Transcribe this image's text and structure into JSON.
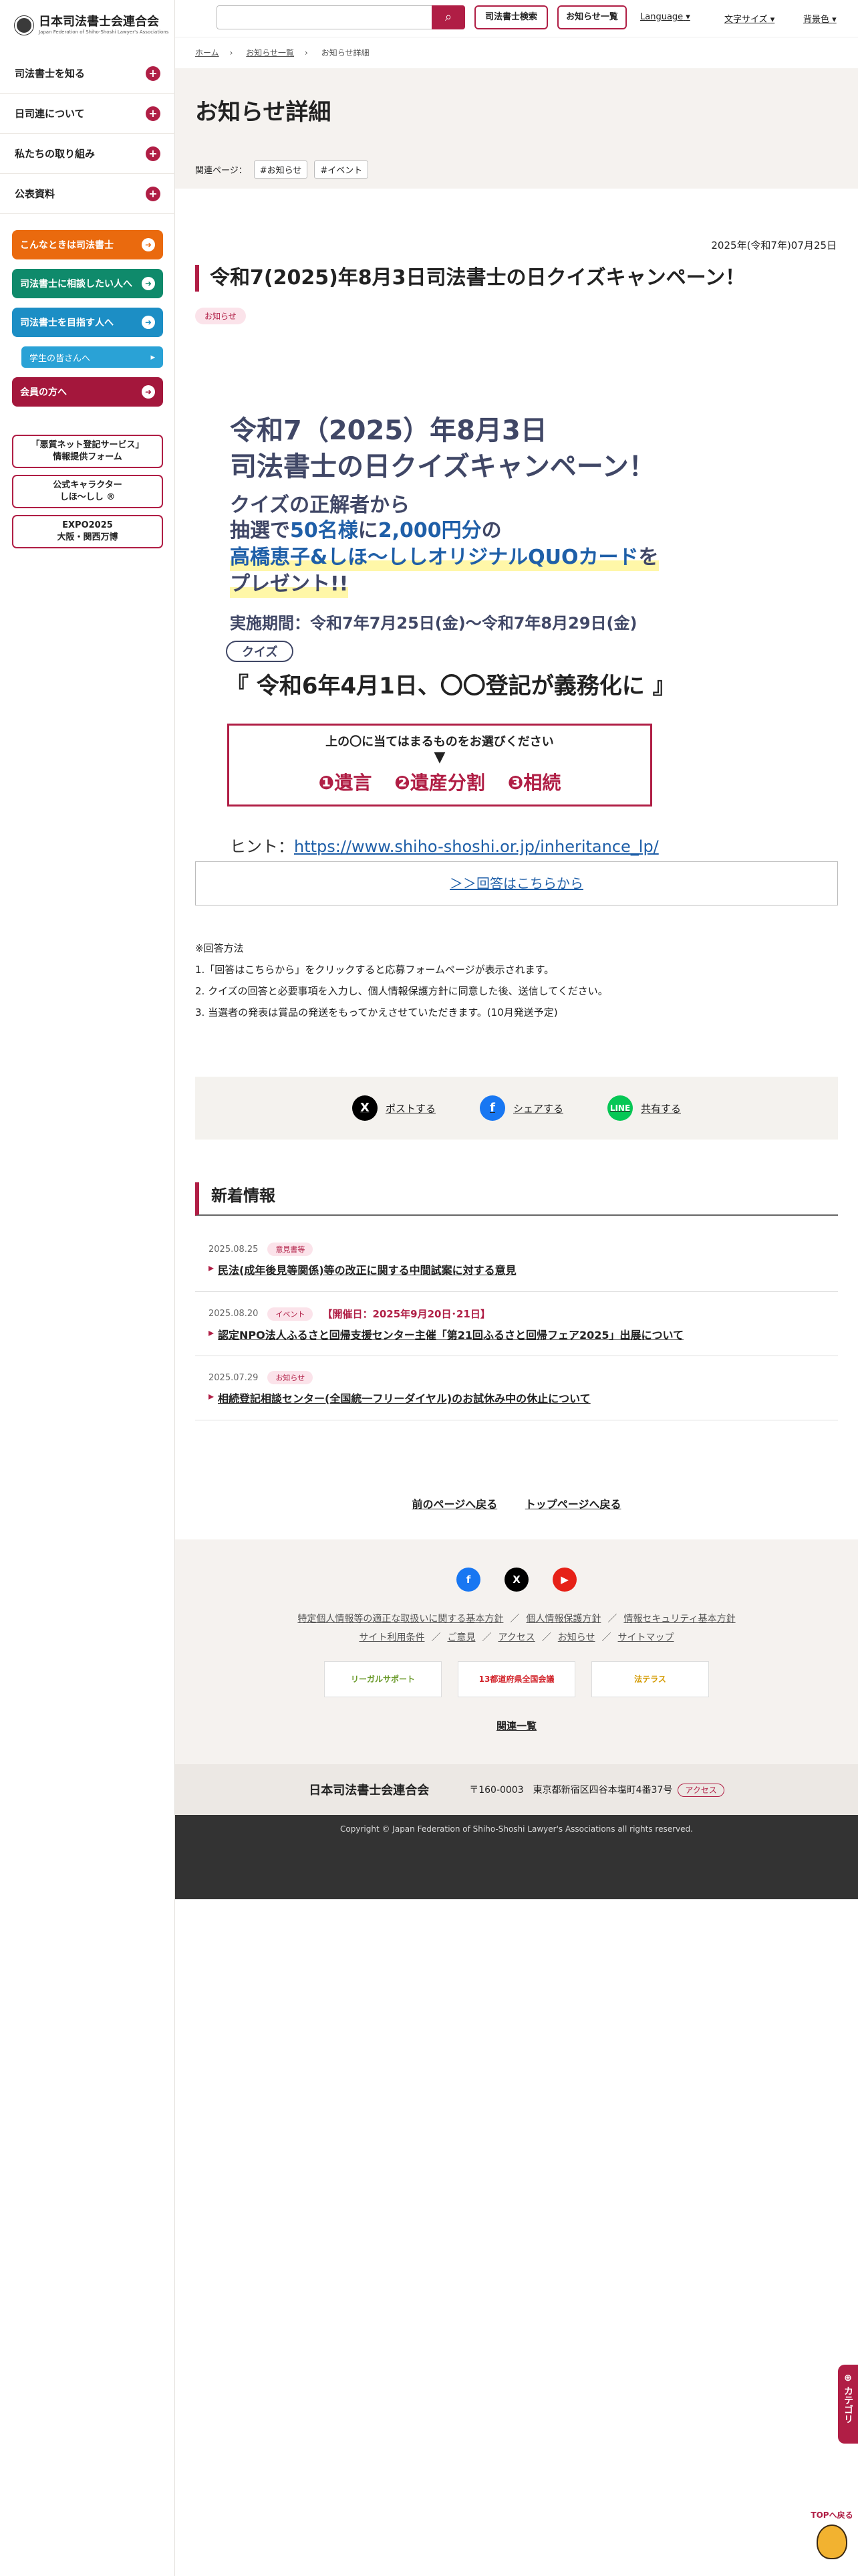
{
  "org": {
    "name": "日本司法書士会連合会",
    "name_en": "Japan Federation of Shiho-Shoshi Lawyer's Associations"
  },
  "header": {
    "search_placeholder": "",
    "btn_find": "司法書士検索",
    "btn_news": "お知らせ一覧",
    "language": "Language",
    "font_size": "文字サイズ",
    "bg_color": "背景色"
  },
  "sidebar": {
    "nav": [
      {
        "label": "司法書士を知る"
      },
      {
        "label": "日司連について"
      },
      {
        "label": "私たちの取り組み"
      },
      {
        "label": "公表資料"
      }
    ],
    "color_buttons": [
      {
        "label": "こんなときは司法書士",
        "color": "#ea6a0e"
      },
      {
        "label": "司法書士に相談したい人へ",
        "color": "#0f8a6b"
      },
      {
        "label": "司法書士を目指す人へ",
        "color": "#1c8ec5"
      },
      {
        "label": "学生の皆さんへ",
        "color": "#2aa2d6"
      },
      {
        "label": "会員の方へ",
        "color": "#a4173c"
      }
    ],
    "outline_buttons": [
      {
        "line1": "「悪質ネット登記サービス」",
        "line2": "情報提供フォーム"
      },
      {
        "line1": "公式キャラクター",
        "line2": "しほ～しし ®"
      },
      {
        "line1": "EXPO2025",
        "line2": "大阪・関西万博"
      }
    ]
  },
  "breadcrumb": [
    "ホーム",
    "お知らせ一覧",
    "お知らせ詳細"
  ],
  "page": {
    "title": "お知らせ詳細",
    "related_label": "関連ページ：",
    "related_tags": [
      "#お知らせ",
      "#イベント"
    ]
  },
  "article": {
    "date": "2025年(令和7年)07月25日",
    "title": "令和7(2025)年8月3日司法書士の日クイズキャンペーン！",
    "category": "お知らせ",
    "campaign": {
      "line1": "令和7（2025）年8月3日",
      "line2": "司法書士の日クイズキャンペーン！",
      "prize1": "クイズの正解者から",
      "prize2a": "抽選で",
      "prize2b": "50名様",
      "prize2c": "に",
      "prize2d": "2,000円分",
      "prize2e": "の",
      "prize3a": "高橋恵子&しほ～しし",
      "prize3b": "オリジナルQUOカード",
      "prize3c": "を",
      "prize4": "プレゼント!!",
      "period": "実施期間：令和7年7月25日(金)～令和7年8月29日(金)",
      "quiz_label": "クイズ",
      "question": "『 令和6年4月1日、〇〇登記が義務化に 』",
      "instruction": "上の〇に当てはまるものをお選びください",
      "down": "▼",
      "options": [
        "❶遺言",
        "❷遺産分割",
        "❸相続"
      ],
      "hint_label": "ヒント：",
      "hint_url": "https://www.shiho-shoshi.or.jp/inheritance_lp/"
    },
    "answer_link": "＞＞回答はこちらから",
    "method_title": "※回答方法",
    "method": [
      "1.「回答はこちらから」をクリックすると応募フォームページが表示されます。",
      "2. クイズの回答と必要事項を入力し、個人情報保護方針に同意した後、送信してください。",
      "3. 当選者の発表は賞品の発送をもってかえさせていただきます。(10月発送予定)"
    ]
  },
  "share": [
    {
      "label": "ポストする",
      "icon": "x-icon",
      "color": "#000000"
    },
    {
      "label": "シェアする",
      "icon": "facebook-icon",
      "color": "#1877f2"
    },
    {
      "label": "共有する",
      "icon": "line-icon",
      "color": "#06c755"
    }
  ],
  "news": {
    "heading": "新着情報",
    "items": [
      {
        "date": "2025.08.25",
        "category": "意見書等",
        "sub": "",
        "title": "民法(成年後見等関係)等の改正に関する中間試案に対する意見"
      },
      {
        "date": "2025.08.20",
        "category": "イベント",
        "sub": "【開催日：2025年9月20日･21日】",
        "title": "認定NPO法人ふるさと回帰支援センター主催「第21回ふるさと回帰フェア2025」出展について"
      },
      {
        "date": "2025.07.29",
        "category": "お知らせ",
        "sub": "",
        "title": "相続登記相談センター(全国統一フリーダイヤル)のお試休み中の休止について"
      }
    ]
  },
  "pager": {
    "prev": "前のページへ戻る",
    "top": "トップページへ戻る"
  },
  "footer": {
    "links1": [
      "特定個人情報等の適正な取扱いに関する基本方針",
      "個人情報保護方針",
      "情報セキュリティ基本方針"
    ],
    "links2": [
      "サイト利用条件",
      "ご意見",
      "アクセス",
      "お知らせ",
      "サイトマップ"
    ],
    "banners": [
      "リーガルサポート",
      "13都道府県全国会議",
      "法テラス"
    ],
    "list_link": "関連一覧",
    "postal": "〒160-0003",
    "address": "東京都新宿区四谷本塩町4番37号",
    "access": "アクセス",
    "copyright": "Copyright © Japan Federation of Shiho-Shoshi Lawyer's Associations all rights reserved."
  },
  "category_tab": "カテゴリ",
  "to_top": "TOPへ戻る"
}
